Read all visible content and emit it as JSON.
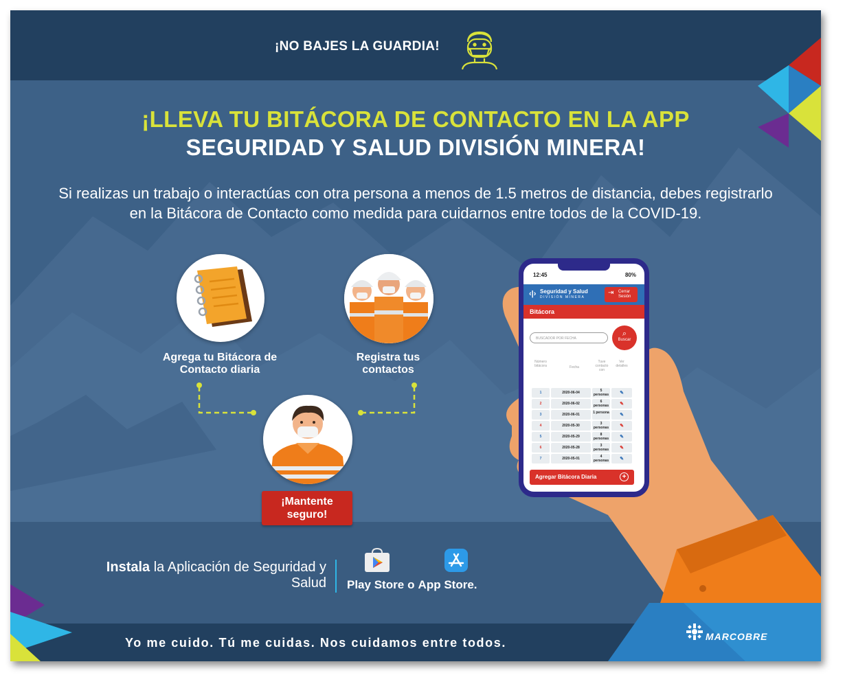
{
  "header": {
    "tagline": "¡NO BAJES LA GUARDIA!",
    "icon": "masked-face-icon"
  },
  "headline": {
    "line1": "¡LLEVA TU BITÁCORA DE CONTACTO EN LA APP",
    "line2": "SEGURIDAD Y SALUD DIVISIÓN MINERA!"
  },
  "intro": "Si realizas un trabajo o interactúas con otra persona a menos de 1.5 metros de distancia, debes registrarlo en la Bitácora de Contacto como medida para cuidarnos entre todos de la COVID-19.",
  "steps": {
    "step1": "Agrega tu Bitácora de Contacto diaria",
    "step2": "Registra tus contactos",
    "cta": "¡Mantente seguro!"
  },
  "phone": {
    "time": "12:45",
    "battery": "80%",
    "app_name": "Seguridad y Salud",
    "app_subtitle": "DIVISIÓN MINERA",
    "logout_label": "Cerrar Sesión",
    "section_title": "Bitácora",
    "search_placeholder": "BUSCADOR POR FECHA",
    "search_button": "Buscar",
    "columns": {
      "number": "Número bitácora",
      "date": "Fecha",
      "contact": "Tuve contacto con",
      "details": "Ver detalles"
    },
    "rows": [
      {
        "num": "1",
        "date": "2020-06-04",
        "people": "5 personas"
      },
      {
        "num": "2",
        "date": "2020-06-02",
        "people": "6 personas"
      },
      {
        "num": "3",
        "date": "2020-06-01",
        "people": "1 persona"
      },
      {
        "num": "4",
        "date": "2020-05-30",
        "people": "3 personas"
      },
      {
        "num": "5",
        "date": "2020-05-29",
        "people": "8 personas"
      },
      {
        "num": "6",
        "date": "2020-05-28",
        "people": "3 personas"
      },
      {
        "num": "7",
        "date": "2020-05-01",
        "people": "4 personas"
      }
    ],
    "add_button": "Agregar Bitácora Diaria"
  },
  "install": {
    "bold": "Instala",
    "rest": "la Aplicación de Seguridad y Salud",
    "play_store": "Play Store",
    "conjunction": "o",
    "app_store": "App Store."
  },
  "footer": {
    "slogan": "Yo me cuido. Tú me cuidas. Nos cuidamos entre todos.",
    "brand": "MARCOBRE"
  },
  "colors": {
    "background": "#3d6187",
    "band": "#22405f",
    "accent_yellow": "#d9e23a",
    "accent_red": "#d9322a",
    "accent_cyan": "#2fb6e6",
    "accent_purple": "#6b2c91",
    "orange": "#ef7d1a"
  }
}
